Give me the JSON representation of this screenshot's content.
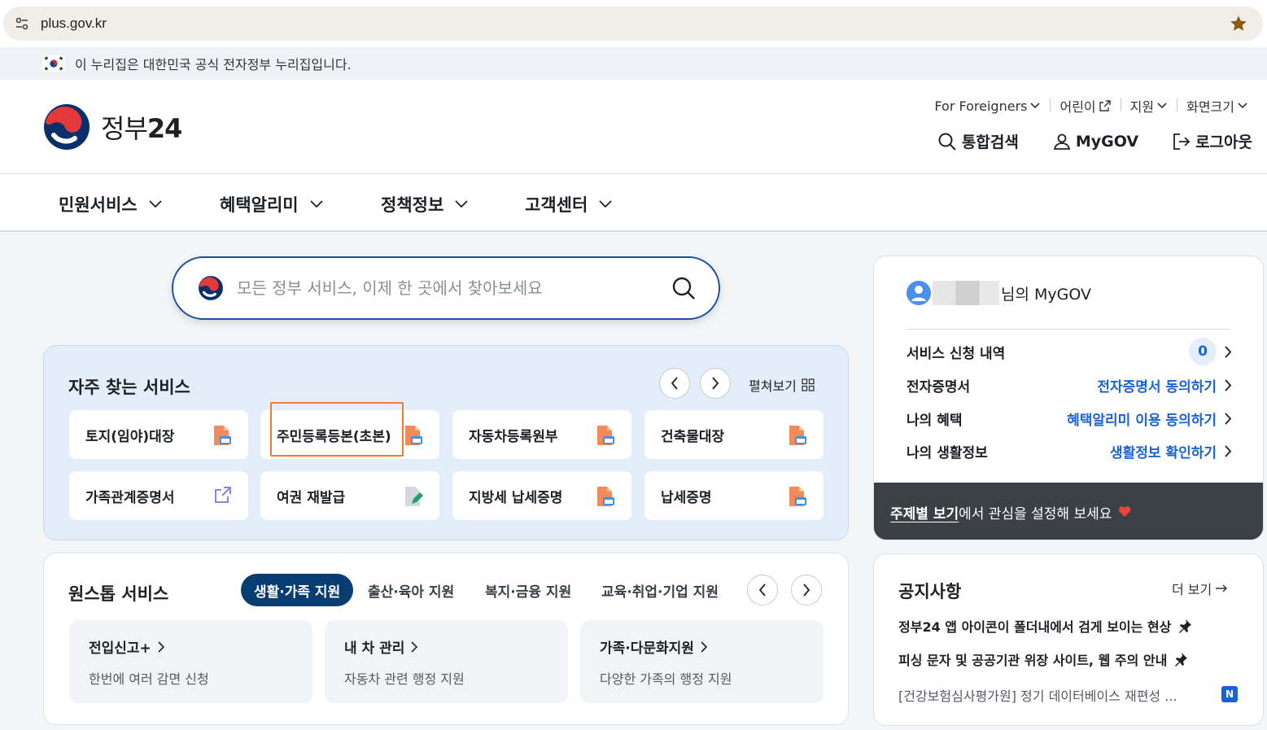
{
  "browser": {
    "url": "plus.gov.kr",
    "site_icon": "tune-icon",
    "bookmark_icon": "star-icon"
  },
  "banner": {
    "text": "이 누리집은 대한민국 공식 전자정부 누리집입니다."
  },
  "header": {
    "logo_text": "정부",
    "logo_num": "24",
    "util": [
      {
        "label": "For Foreigners"
      },
      {
        "label": "어린이"
      },
      {
        "label": "지원"
      },
      {
        "label": "화면크기"
      }
    ],
    "actions": {
      "search": "통합검색",
      "mygov": "MyGOV",
      "logout": "로그아웃"
    }
  },
  "gnb": [
    "민원서비스",
    "혜택알리미",
    "정책정보",
    "고객센터"
  ],
  "search": {
    "placeholder": "모든 정부 서비스, 이제 한 곳에서 찾아보세요"
  },
  "favorites": {
    "title": "자주 찾는 서비스",
    "expand": "펼쳐보기",
    "items": [
      {
        "label": "토지(임야)대장",
        "icon": "pdf-icon"
      },
      {
        "label": "주민등록등본(초본)",
        "icon": "pdf-icon"
      },
      {
        "label": "자동차등록원부",
        "icon": "pdf-icon"
      },
      {
        "label": "건축물대장",
        "icon": "pdf-icon"
      },
      {
        "label": "가족관계증명서",
        "icon": "external-link-icon"
      },
      {
        "label": "여권 재발급",
        "icon": "edit-icon"
      },
      {
        "label": "지방세 납세증명",
        "icon": "pdf-icon"
      },
      {
        "label": "납세증명",
        "icon": "pdf-icon"
      }
    ]
  },
  "onestop": {
    "title": "원스톱 서비스",
    "tabs": [
      "생활·가족 지원",
      "출산·육아 지원",
      "복지·금융 지원",
      "교육·취업·기업 지원"
    ],
    "cards": [
      {
        "title": "전입신고+",
        "desc": "한번에 여러 감면 신청"
      },
      {
        "title": "내 차 관리",
        "desc": "자동차 관련 행정 지원"
      },
      {
        "title": "가족·다문화지원",
        "desc": "다양한 가족의 행정 지원"
      }
    ]
  },
  "mygov": {
    "user_suffix": "님의 MyGOV",
    "rows": [
      {
        "label": "서비스 신청 내역",
        "value": "0"
      },
      {
        "label": "전자증명서",
        "value": "전자증명서 동의하기"
      },
      {
        "label": "나의 혜택",
        "value": "혜택알리미 이용 동의하기"
      },
      {
        "label": "나의 생활정보",
        "value": "생활정보 확인하기"
      }
    ],
    "footer_link": "주제별 보기",
    "footer_text": "에서 관심을 설정해 보세요"
  },
  "notice": {
    "title": "공지사항",
    "more": "더 보기",
    "items": [
      {
        "text": "정부24 앱 아이콘이 폴더내에서 검게 보이는 현상"
      },
      {
        "text": "피싱 문자 및 공공기관 위장 사이트, 웹 주의 안내"
      },
      {
        "text": "[건강보험심사평가원] 정기 데이터베이스 재편성 ..."
      }
    ],
    "new_badge": "N"
  },
  "colors": {
    "primary": "#1c4fa6",
    "active_tab": "#073d72",
    "link": "#1a63d6",
    "highlight": "#ef7a3a"
  }
}
